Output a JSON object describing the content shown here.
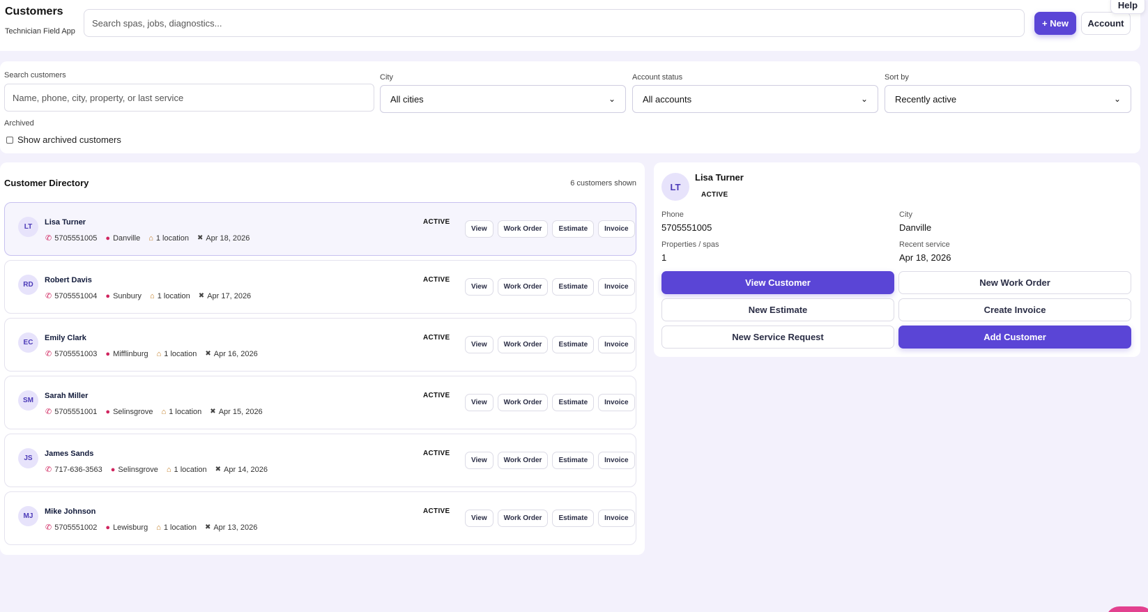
{
  "header": {
    "title": "Customers",
    "subtitle": "Technician Field App",
    "search_placeholder": "Search spas, jobs, diagnostics...",
    "new_label": "+ New",
    "account_label": "Account",
    "help_label": "Help"
  },
  "filters": {
    "search_label": "Search customers",
    "search_placeholder": "Name, phone, city, property, or last service",
    "city_label": "City",
    "city_value": "All cities",
    "status_label": "Account status",
    "status_value": "All accounts",
    "sort_label": "Sort by",
    "sort_value": "Recently active",
    "archived_label": "Archived",
    "archived_checkbox_label": "Show archived customers"
  },
  "directory": {
    "title": "Customer Directory",
    "count_text": "6 customers shown",
    "action_labels": {
      "view": "View",
      "work_order": "Work Order",
      "estimate": "Estimate",
      "invoice": "Invoice"
    },
    "customers": [
      {
        "initials": "LT",
        "name": "Lisa Turner",
        "phone": "5705551005",
        "city": "Danville",
        "locations": "1 location",
        "last_service": "Apr 18, 2026",
        "status": "ACTIVE",
        "selected": true
      },
      {
        "initials": "RD",
        "name": "Robert Davis",
        "phone": "5705551004",
        "city": "Sunbury",
        "locations": "1 location",
        "last_service": "Apr 17, 2026",
        "status": "ACTIVE",
        "selected": false
      },
      {
        "initials": "EC",
        "name": "Emily Clark",
        "phone": "5705551003",
        "city": "Mifflinburg",
        "locations": "1 location",
        "last_service": "Apr 16, 2026",
        "status": "ACTIVE",
        "selected": false
      },
      {
        "initials": "SM",
        "name": "Sarah Miller",
        "phone": "5705551001",
        "city": "Selinsgrove",
        "locations": "1 location",
        "last_service": "Apr 15, 2026",
        "status": "ACTIVE",
        "selected": false
      },
      {
        "initials": "JS",
        "name": "James Sands",
        "phone": "717-636-3563",
        "city": "Selinsgrove",
        "locations": "1 location",
        "last_service": "Apr 14, 2026",
        "status": "ACTIVE",
        "selected": false
      },
      {
        "initials": "MJ",
        "name": "Mike Johnson",
        "phone": "5705551002",
        "city": "Lewisburg",
        "locations": "1 location",
        "last_service": "Apr 13, 2026",
        "status": "ACTIVE",
        "selected": false
      }
    ]
  },
  "detail": {
    "initials": "LT",
    "name": "Lisa Turner",
    "status": "ACTIVE",
    "phone_label": "Phone",
    "phone_value": "5705551005",
    "city_label": "City",
    "city_value": "Danville",
    "properties_label": "Properties / spas",
    "properties_value": "1",
    "recent_label": "Recent service",
    "recent_value": "Apr 18, 2026",
    "buttons": {
      "view_customer": "View Customer",
      "new_work_order": "New Work Order",
      "new_estimate": "New Estimate",
      "create_invoice": "Create Invoice",
      "new_service_request": "New Service Request",
      "add_customer": "Add Customer"
    }
  },
  "colors": {
    "accent": "#5a45d6",
    "background": "#f3f1fc",
    "icon_pink": "#d0245e",
    "fab": "#e2418f"
  },
  "icons": {
    "phone": "phone-icon",
    "location": "map-pin-icon",
    "property": "house-icon",
    "service": "tools-icon"
  }
}
